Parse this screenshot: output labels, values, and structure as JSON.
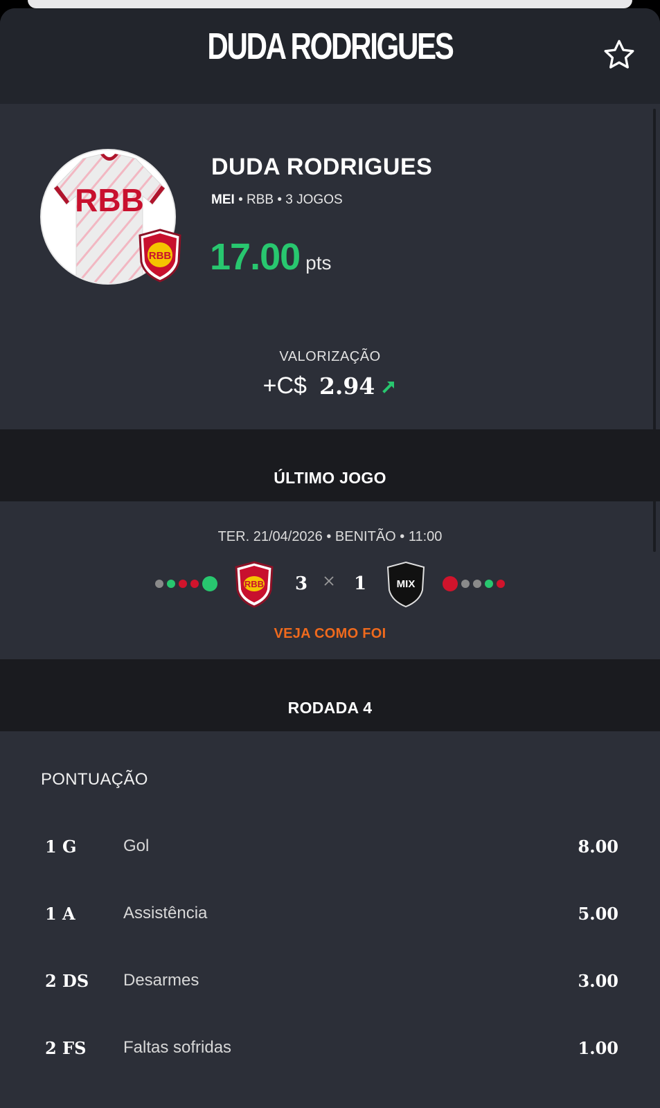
{
  "header": {
    "title": "DUDA RODRIGUES",
    "favorite_icon": "star-outline-icon"
  },
  "player": {
    "name": "DUDA RODRIGUES",
    "position": "MEI",
    "club": "RBB",
    "games": "3 JOGOS",
    "separator": "•",
    "points": "17.00",
    "points_unit": "pts",
    "jersey_text": "RBB",
    "badge_text": "RBB"
  },
  "valorizacao": {
    "label": "VALORIZAÇÃO",
    "prefix": "+C$",
    "value": "2.94",
    "trend_icon": "arrow-up-right-icon"
  },
  "last_match": {
    "section_title": "ÚLTIMO JOGO",
    "info": "TER. 21/04/2026 • BENITÃO • 11:00",
    "home": {
      "badge_text": "RBB",
      "score": "3",
      "form": [
        "#8a8a8a",
        "#28c76f",
        "#d0142c",
        "#d0142c",
        "#28c76f"
      ]
    },
    "away": {
      "badge_text": "MIX",
      "score": "1",
      "form": [
        "#d0142c",
        "#8a8a8a",
        "#8a8a8a",
        "#28c76f",
        "#d0142c"
      ]
    },
    "link": "VEJA COMO FOI"
  },
  "round": {
    "section_title": "RODADA 4",
    "score_label": "PONTUAÇÃO",
    "stats": [
      {
        "code": "1 G",
        "name": "Gol",
        "value": "8.00"
      },
      {
        "code": "1 A",
        "name": "Assistência",
        "value": "5.00"
      },
      {
        "code": "2 DS",
        "name": "Desarmes",
        "value": "3.00"
      },
      {
        "code": "2 FS",
        "name": "Faltas sofridas",
        "value": "1.00"
      }
    ]
  },
  "colors": {
    "positive": "#28c76f",
    "negative": "#d0142c",
    "neutral": "#8a8a8a",
    "link": "#f06a1d",
    "club_red": "#c8102e",
    "club_yellow": "#f5c400"
  }
}
